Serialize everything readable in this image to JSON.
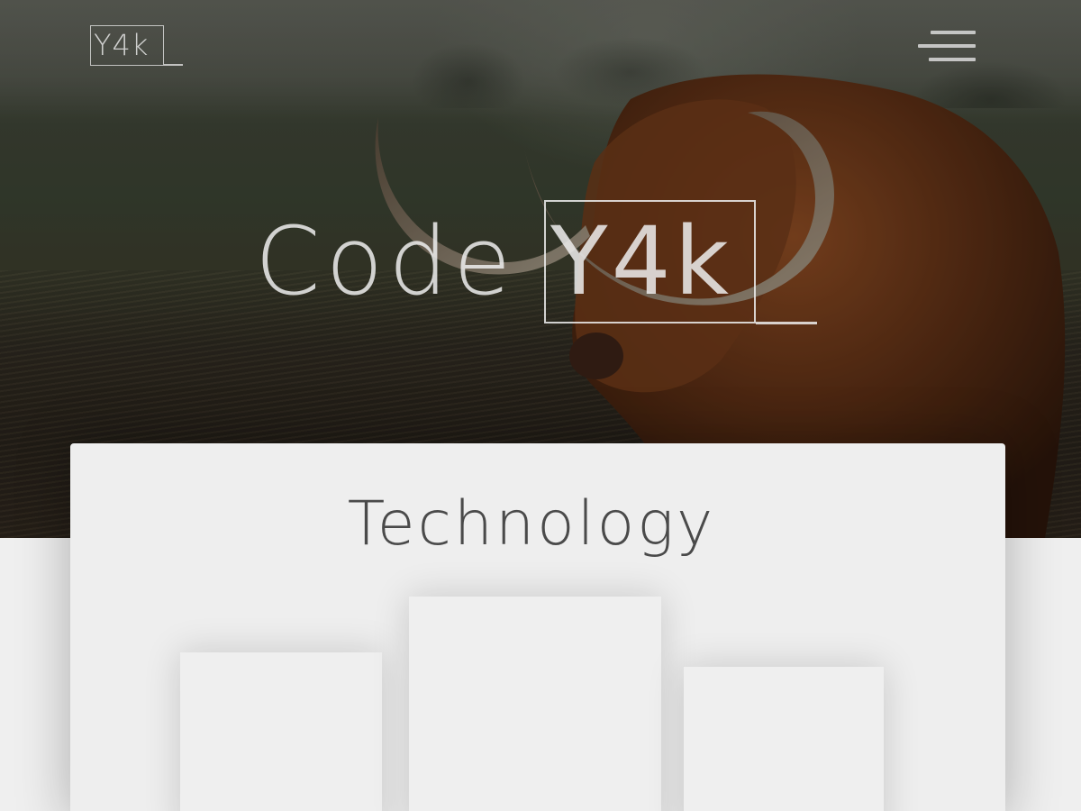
{
  "header": {
    "logo_text": "Y4k",
    "menu_icon": "hamburger-icon"
  },
  "hero": {
    "brand_prefix": "Code",
    "brand_mark": "Y4k",
    "background_image": "highland cattle in misty field"
  },
  "section": {
    "title": "Technology"
  },
  "colors": {
    "card_background": "#eeeeee",
    "title_text": "#4a4a4a",
    "overlay_text": "#eeeeee"
  }
}
